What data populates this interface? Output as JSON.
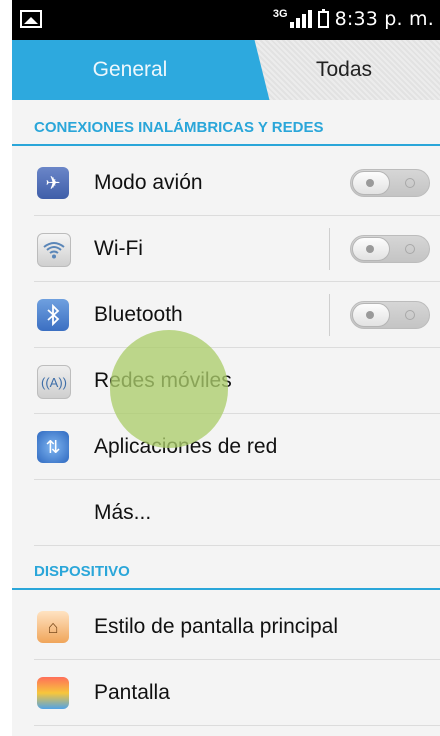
{
  "status_bar": {
    "left_icon": "image-notification-icon",
    "network_type": "3G",
    "signal_icon": "signal-icon",
    "battery_icon": "battery-icon",
    "time": "8:33 p. m."
  },
  "tabs": [
    {
      "label": "General",
      "selected": true
    },
    {
      "label": "Todas",
      "selected": false
    }
  ],
  "sections": {
    "wireless": "CONEXIONES INALÁMBRICAS Y REDES",
    "device": "DISPOSITIVO"
  },
  "items": {
    "airplane": {
      "label": "Modo avión",
      "icon": "airplane-icon",
      "toggle": "off"
    },
    "wifi": {
      "label": "Wi-Fi",
      "icon": "wifi-icon",
      "toggle": "off"
    },
    "bluetooth": {
      "label": "Bluetooth",
      "icon": "bluetooth-icon",
      "toggle": "off"
    },
    "mobile": {
      "label": "Redes móviles",
      "icon": "mobile-network-icon"
    },
    "netapps": {
      "label": "Aplicaciones de red",
      "icon": "network-apps-icon"
    },
    "more": {
      "label": "Más..."
    },
    "home_style": {
      "label": "Estilo de pantalla principal",
      "icon": "home-icon"
    },
    "display": {
      "label": "Pantalla",
      "icon": "display-icon"
    }
  },
  "colors": {
    "accent": "#2da9de",
    "touch_indicator": "#acd16c"
  }
}
